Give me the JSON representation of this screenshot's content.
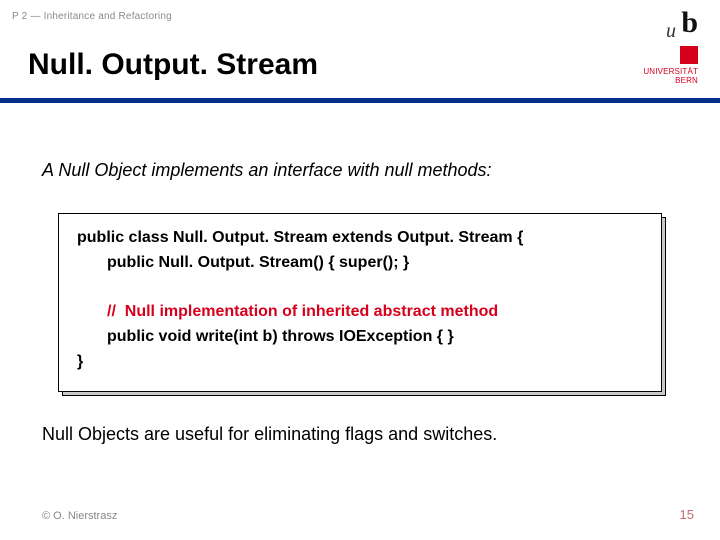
{
  "header": {
    "breadcrumb": "P 2 — Inheritance and Refactoring",
    "title": "Null. Output. Stream"
  },
  "logo": {
    "u": "u",
    "b": "b",
    "uni_line1": "UNIVERSITÄT",
    "uni_line2": "BERN"
  },
  "content": {
    "intro": "A Null Object implements an interface with null methods:",
    "code": {
      "l1": "public class Null. Output. Stream extends Output. Stream {",
      "l2": "public Null. Output. Stream() { super(); }",
      "l3": "//  Null implementation of inherited abstract method",
      "l4": "public void write(int b) throws IOException { }",
      "l5": "}"
    },
    "conclude": "Null Objects are useful for eliminating flags and switches."
  },
  "footer": {
    "copyright": "© O. Nierstrasz",
    "page": "15"
  }
}
